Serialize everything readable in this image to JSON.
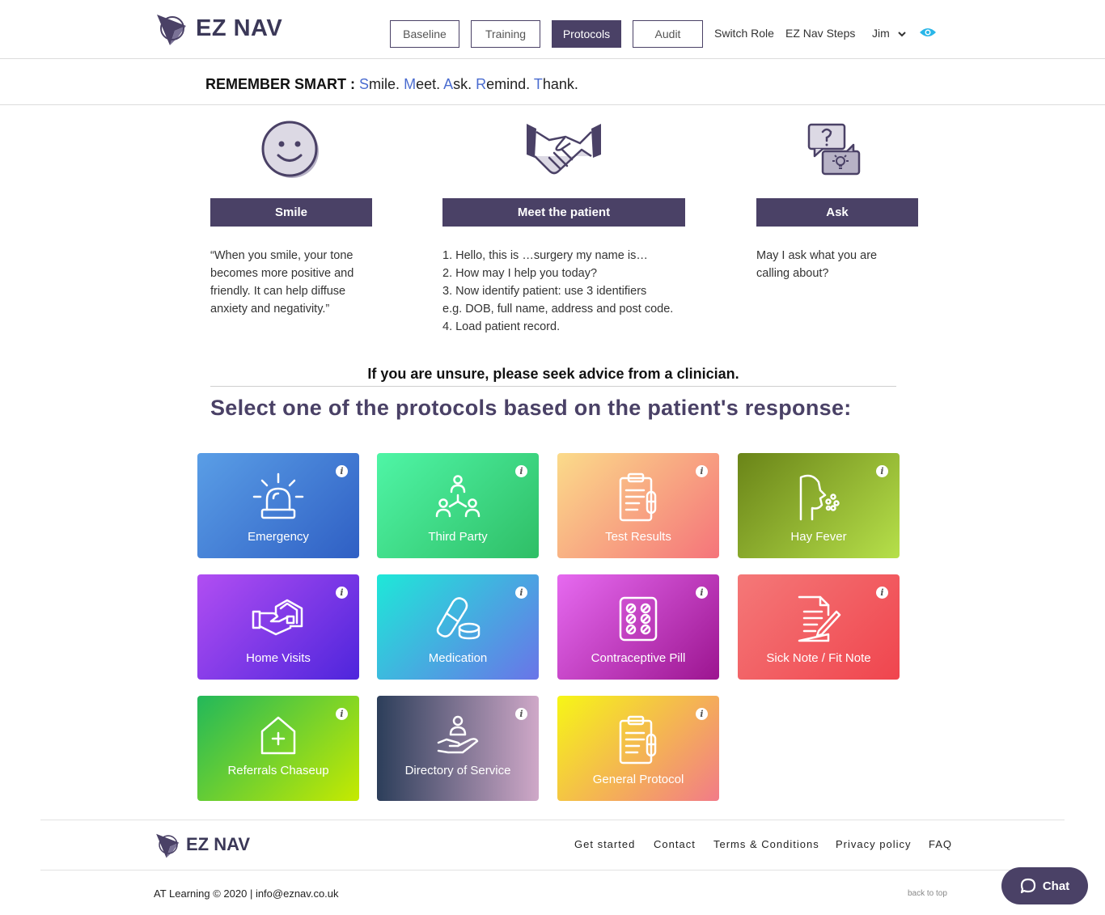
{
  "header": {
    "logo_text": "EZ NAV",
    "nav": [
      {
        "label": "Baseline",
        "active": false
      },
      {
        "label": "Training",
        "active": false
      },
      {
        "label": "Protocols",
        "active": true
      },
      {
        "label": "Audit",
        "active": false
      }
    ],
    "links": {
      "switch_role": "Switch Role",
      "steps": "EZ Nav Steps",
      "user": "Jim"
    },
    "accent_color": "#4a4166",
    "eye_color": "#29b6e8"
  },
  "remember": {
    "label": "REMEMBER SMART :",
    "words": [
      {
        "first": "S",
        "rest": "mile."
      },
      {
        "first": "M",
        "rest": "eet."
      },
      {
        "first": "A",
        "rest": "sk."
      },
      {
        "first": "R",
        "rest": "emind."
      },
      {
        "first": "T",
        "rest": "hank."
      }
    ]
  },
  "columns": [
    {
      "icon": "smiley-icon",
      "title": "Smile",
      "lines": [
        "“When you smile, your tone",
        "becomes more positive and",
        "friendly. It can help diffuse",
        "anxiety and negativity.”"
      ]
    },
    {
      "icon": "handshake-icon",
      "title": "Meet the patient",
      "lines": [
        "1. Hello, this is …surgery my name is…",
        "2. How may I help you today?",
        "3. Now identify patient: use 3 identifiers",
        "e.g. DOB, full name, address and post code.",
        "4. Load patient record."
      ]
    },
    {
      "icon": "question-bubbles-icon",
      "title": "Ask",
      "lines": [
        "May I ask what you are",
        "calling about?"
      ]
    }
  ],
  "unsure_text": "If you are unsure, please seek advice from a clinician.",
  "select_title": "Select one of the protocols based on the patient's response:",
  "tiles": [
    {
      "label": "Emergency",
      "icon": "siren-icon",
      "info": "i"
    },
    {
      "label": "Third Party",
      "icon": "people-network-icon",
      "info": "i"
    },
    {
      "label": "Test Results",
      "icon": "clipboard-test-icon",
      "info": "i"
    },
    {
      "label": "Hay Fever",
      "icon": "head-pollen-icon",
      "info": "i"
    },
    {
      "label": "Home Visits",
      "icon": "hand-house-icon",
      "info": "i"
    },
    {
      "label": "Medication",
      "icon": "pill-capsule-icon",
      "info": "i"
    },
    {
      "label": "Contraceptive Pill",
      "icon": "pill-pack-icon",
      "info": "i"
    },
    {
      "label": "Sick Note / Fit Note",
      "icon": "note-pen-icon",
      "info": "i"
    },
    {
      "label": "Referrals Chaseup",
      "icon": "house-plus-icon",
      "info": "i"
    },
    {
      "label": "Directory of Service",
      "icon": "hand-person-icon",
      "info": "i"
    },
    {
      "label": "General Protocol",
      "icon": "clipboard-general-icon",
      "info": "i"
    }
  ],
  "footer": {
    "logo_text": "EZ NAV",
    "links": [
      "Get started",
      "Contact",
      "Terms & Conditions",
      "Privacy policy",
      "FAQ"
    ],
    "copyright": "AT Learning © 2020 | info@eznav.co.uk",
    "back_to_top": "back to top",
    "chat": "Chat"
  }
}
